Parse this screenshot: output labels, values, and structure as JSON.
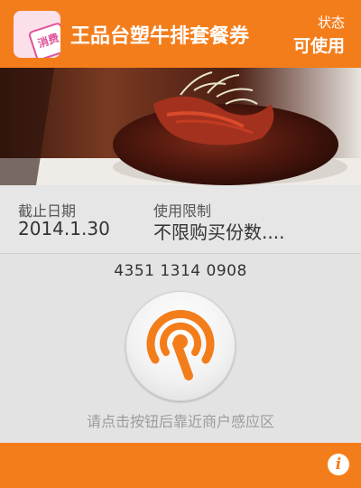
{
  "header": {
    "logo_text": "消费",
    "title": "王品台塑牛排套餐券",
    "status_label": "状态",
    "status_value": "可使用"
  },
  "photo": {
    "icon": "steak-photo"
  },
  "info": {
    "expiry_label": "截止日期",
    "expiry_value": "2014.1.30",
    "limit_label": "使用限制",
    "limit_value": "不限购买份数...."
  },
  "coupon_code": "4351 1314 0908",
  "tap_button": {
    "icon": "nfc-tap-icon"
  },
  "hint": "请点击按钮后靠近商户感应区",
  "footer": {
    "info_icon_text": "i"
  },
  "colors": {
    "accent": "#f47d1b",
    "logo_pink": "#e0529b"
  }
}
